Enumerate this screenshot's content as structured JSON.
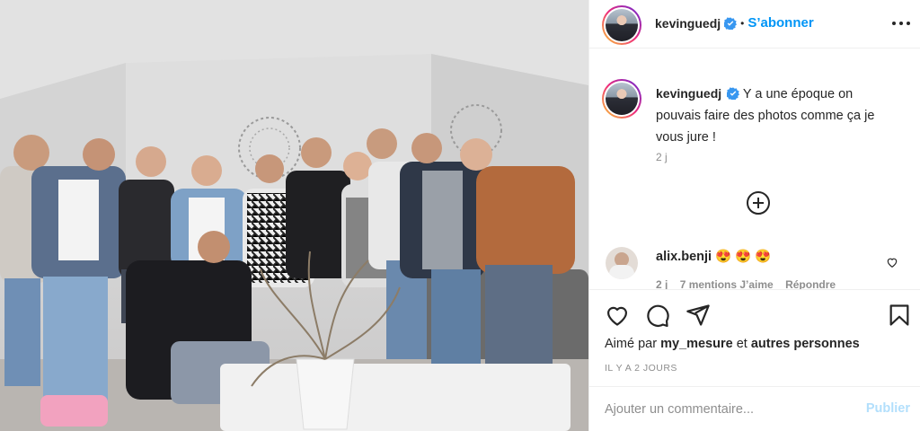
{
  "post": {
    "username": "kevinguedj",
    "follow_label": "S’abonner",
    "dot": "•",
    "caption": "Y a une époque on pouvais faire des photos comme ça je vous jure !",
    "caption_age": "2 j",
    "likes_prefix": "Aimé par",
    "likes_user": "my_mesure",
    "likes_joiner": "et",
    "likes_others": "autres personnes",
    "date": "IL Y A 2 JOURS"
  },
  "comment": {
    "username": "alix.benji",
    "text": "😍 😍 😍",
    "age": "2 j",
    "mentions": "7 mentions J’aime",
    "reply": "Répondre"
  },
  "add_comment": {
    "placeholder": "Ajouter un commentaire...",
    "post_label": "Publier"
  },
  "icons": {
    "verified": "verified-badge-icon",
    "more": "more-options-icon",
    "load_more": "plus-circle-icon",
    "like": "heart-icon",
    "comment": "comment-icon",
    "share": "share-icon",
    "save": "bookmark-icon"
  },
  "colors": {
    "accent": "#0095f6",
    "verified": "#3897f0",
    "text": "#262626",
    "muted": "#8e8e8e"
  }
}
